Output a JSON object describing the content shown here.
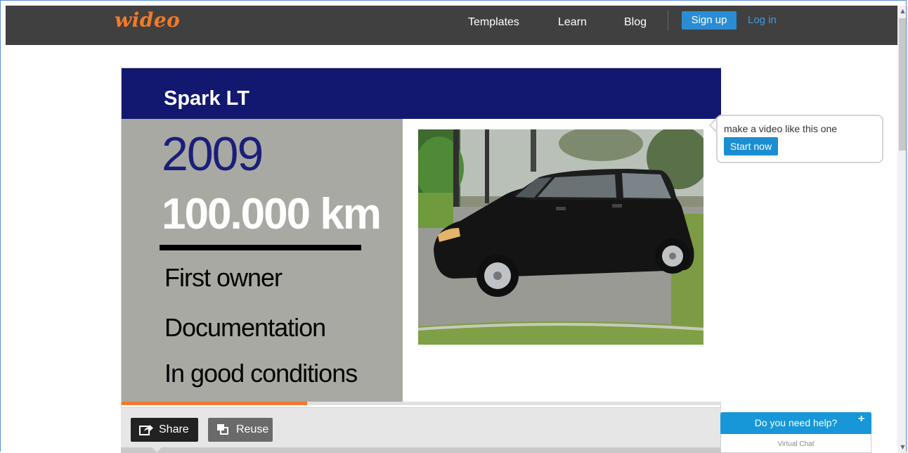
{
  "header": {
    "logo": "wideo",
    "nav": [
      "Templates",
      "Learn",
      "Blog"
    ],
    "signup_label": "Sign up",
    "login_label": "Log in"
  },
  "video": {
    "title": "Spark LT",
    "year": "2009",
    "mileage": "100.000 km",
    "features": [
      "First owner",
      "Documentation",
      "In good conditions"
    ],
    "progress_fraction": 0.31
  },
  "controls": {
    "share_label": "Share",
    "reuse_label": "Reuse"
  },
  "cta": {
    "text": "make a video like this one",
    "button_label": "Start now"
  },
  "chat": {
    "title": "Do you need help?",
    "plus": "+",
    "subtitle": "Virtual Chat"
  },
  "colors": {
    "brand_orange": "#f37a27",
    "title_navy": "#121770",
    "accent_blue": "#2a8dd4"
  }
}
